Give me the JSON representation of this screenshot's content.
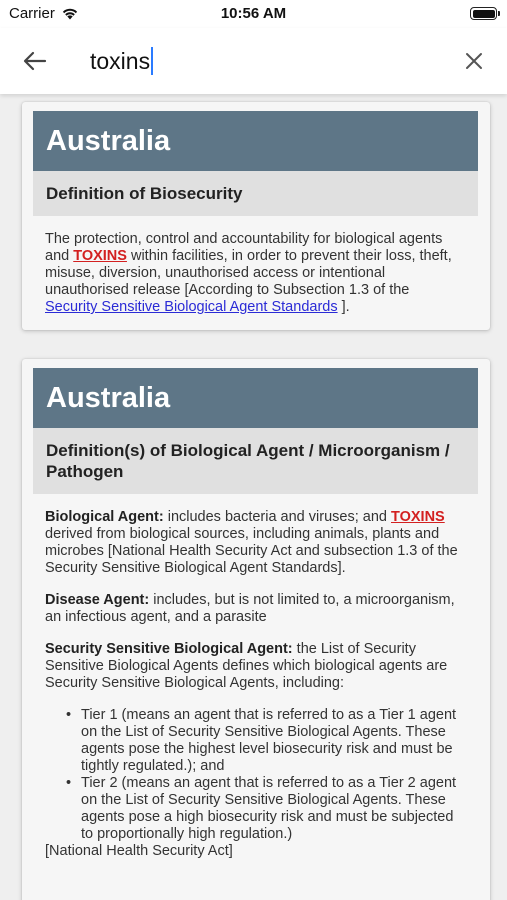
{
  "status_bar": {
    "carrier": "Carrier",
    "time": "10:56 AM"
  },
  "search": {
    "query": "toxins",
    "back_icon": "arrow-left-icon",
    "clear_icon": "close-icon"
  },
  "results": [
    {
      "country": "Australia",
      "section_title": "Definition of Biosecurity",
      "text_before": "The protection, control and accountability for biological agents and ",
      "highlight": "TOXINS",
      "text_after": " within facilities, in order to prevent their loss, theft, misuse, diversion, unauthorised access or intentional unauthorised release [According to Subsection 1.3 of the ",
      "link_text": "Security Sensitive Biological Agent Standards",
      "text_end": " ]."
    },
    {
      "country": "Australia",
      "section_title": "Definition(s) of Biological Agent / Microorganism / Pathogen",
      "biological_agent_term": "Biological Agent:",
      "biological_agent_before": " includes bacteria and viruses; and ",
      "biological_agent_highlight": "TOXINS",
      "biological_agent_after": " derived from biological sources, including animals, plants and microbes [National Health Security Act and subsection 1.3 of the Security Sensitive Biological Agent Standards].",
      "disease_agent_term": "Disease Agent:",
      "disease_agent_text": " includes, but is not limited to, a microorganism, an infectious agent, and a parasite",
      "ssba_term": "Security Sensitive Biological Agent:",
      "ssba_text": " the List of Security Sensitive Biological Agents defines which biological agents are Security Sensitive Biological Agents, including:",
      "tiers": [
        "Tier 1 (means an agent that is referred to as a Tier 1 agent on the List of Security Sensitive Biological Agents. These agents pose the highest level biosecurity risk and must be tightly regulated.); and",
        "Tier 2 (means an agent that is referred to as a Tier 2 agent on the List of Security Sensitive Biological Agents. These agents pose a high biosecurity risk and must be subjected to proportionally high regulation.)"
      ],
      "source_note": "[National Health Security Act]"
    }
  ],
  "colors": {
    "country_header_bg": "#5e7687",
    "section_header_bg": "#e0e0e0",
    "highlight": "#d32020",
    "link": "#2b2bd6",
    "caret": "#2a7bff"
  }
}
